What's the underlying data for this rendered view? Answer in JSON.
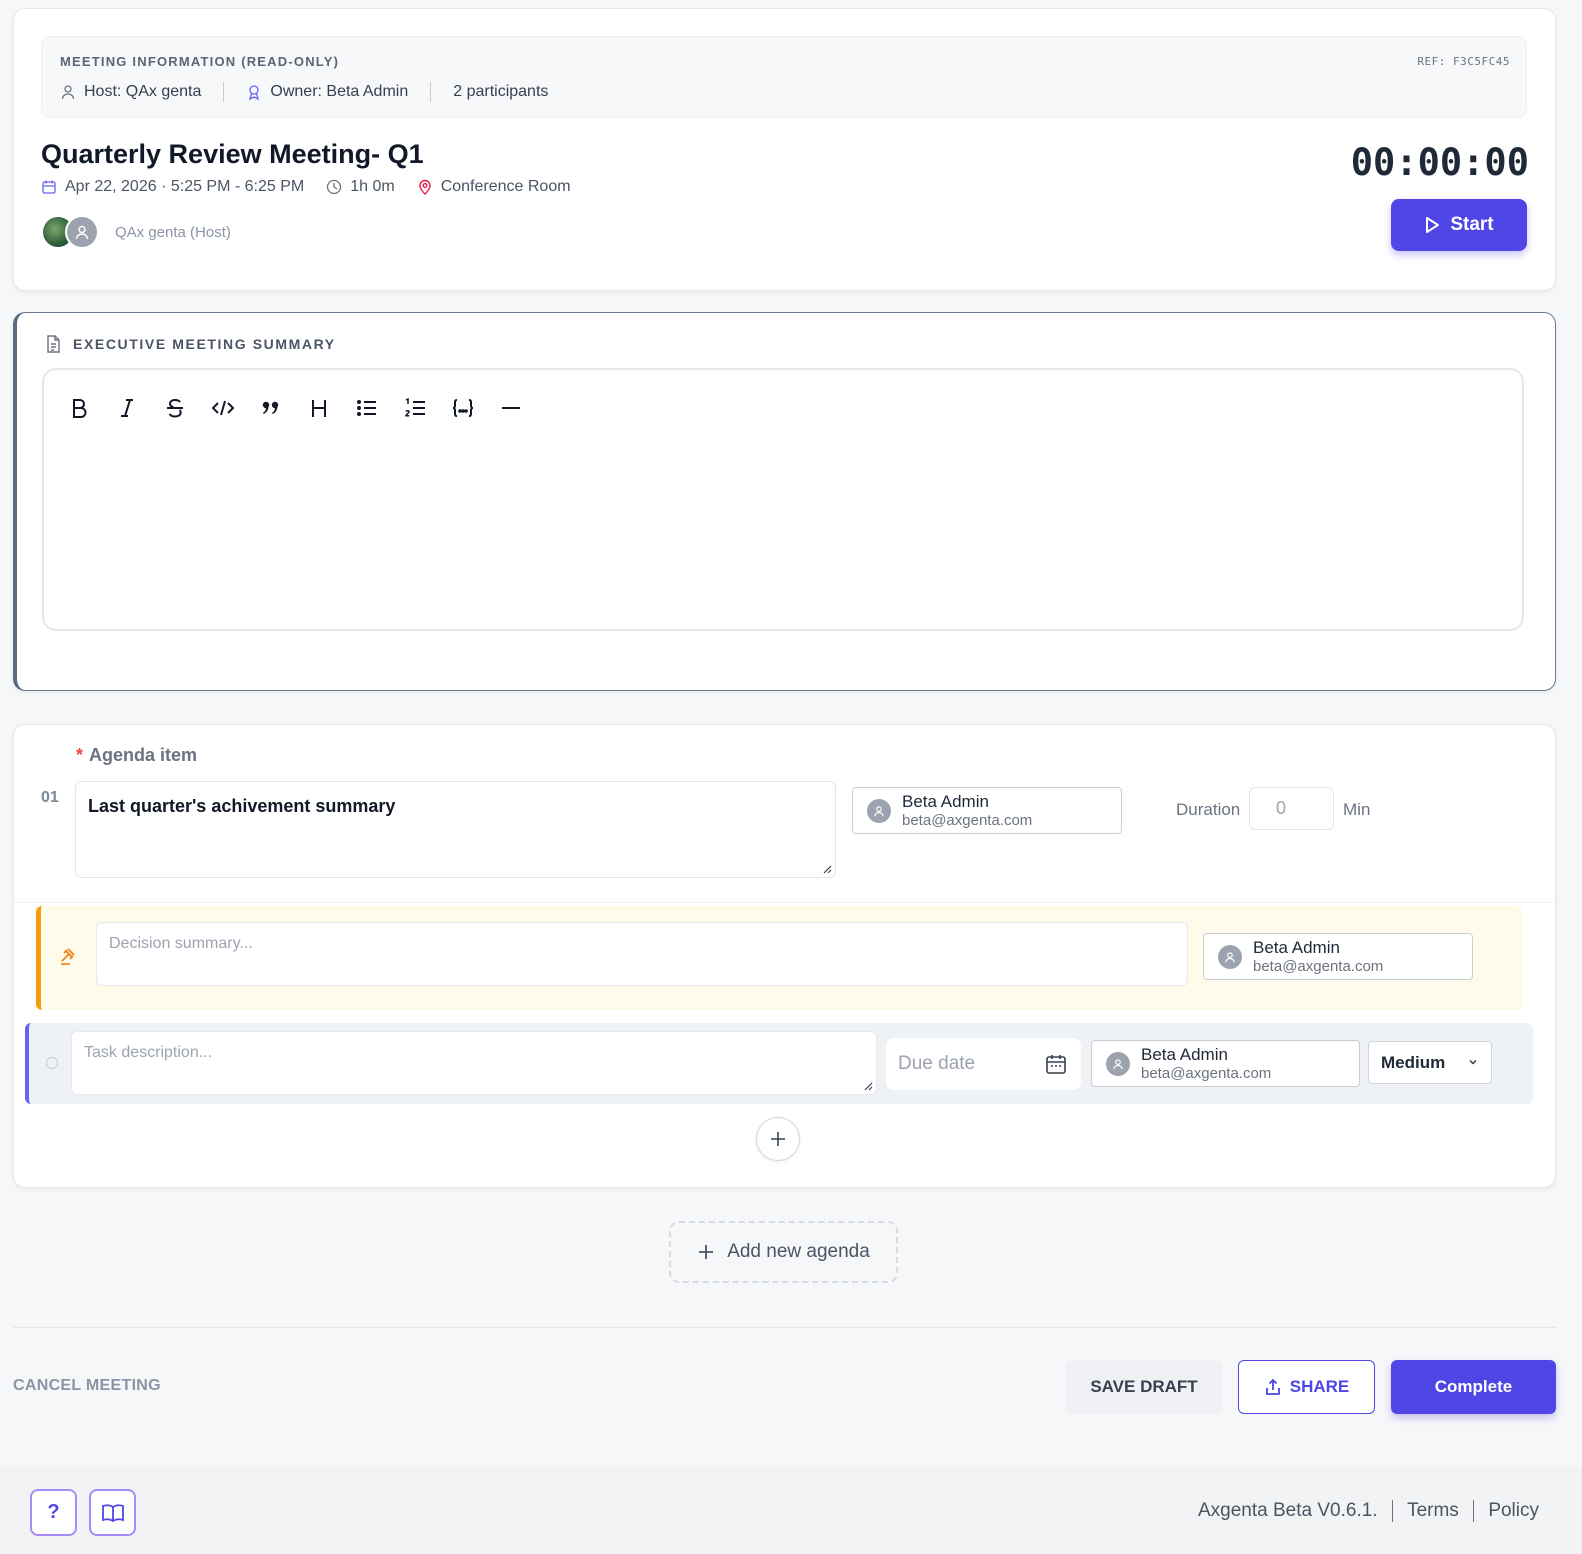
{
  "meeting_info": {
    "title": "MEETING INFORMATION (READ-ONLY)",
    "ref": "REF: F3C5FC45",
    "host": "Host: QAx genta",
    "owner": "Owner: Beta Admin",
    "participants": "2 participants"
  },
  "meeting": {
    "title": "Quarterly Review Meeting- Q1",
    "datetime": "Apr 22, 2026 · 5:25 PM - 6:25 PM",
    "duration": "1h 0m",
    "location": "Conference Room",
    "host_label": "QAx genta (Host)",
    "timer": "00:00:00",
    "start_label": "Start"
  },
  "summary": {
    "heading": "EXECUTIVE MEETING SUMMARY",
    "toolbar": [
      "bold-icon",
      "italic-icon",
      "strikethrough-icon",
      "code-icon",
      "quote-icon",
      "heading-icon",
      "bullet-list-icon",
      "ordered-list-icon",
      "code-block-icon",
      "horizontal-rule-icon"
    ]
  },
  "agenda": {
    "label": "Agenda item",
    "required_mark": "*",
    "number": "01",
    "text": "Last quarter's achivement summary",
    "owner_name": "Beta Admin",
    "owner_email": "beta@axgenta.com",
    "duration_label": "Duration",
    "duration_value": "0",
    "duration_unit": "Min",
    "decision_placeholder": "Decision summary...",
    "decision_owner_name": "Beta Admin",
    "decision_owner_email": "beta@axgenta.com",
    "task_placeholder": "Task description...",
    "due_date_placeholder": "Due date",
    "task_owner_name": "Beta Admin",
    "task_owner_email": "beta@axgenta.com",
    "priority": "Medium"
  },
  "actions": {
    "add_agenda": "Add new agenda",
    "cancel": "CANCEL MEETING",
    "save_draft": "SAVE DRAFT",
    "share": "SHARE",
    "complete": "Complete"
  },
  "footer": {
    "help": "?",
    "version": "Axgenta  Beta V0.6.1.",
    "terms": "Terms",
    "policy": "Policy"
  },
  "colors": {
    "primary": "#4f46e5",
    "decision_accent": "#f59e0b",
    "task_accent": "#6366f1",
    "required": "#ef4444",
    "location_pin": "#e11d48"
  }
}
